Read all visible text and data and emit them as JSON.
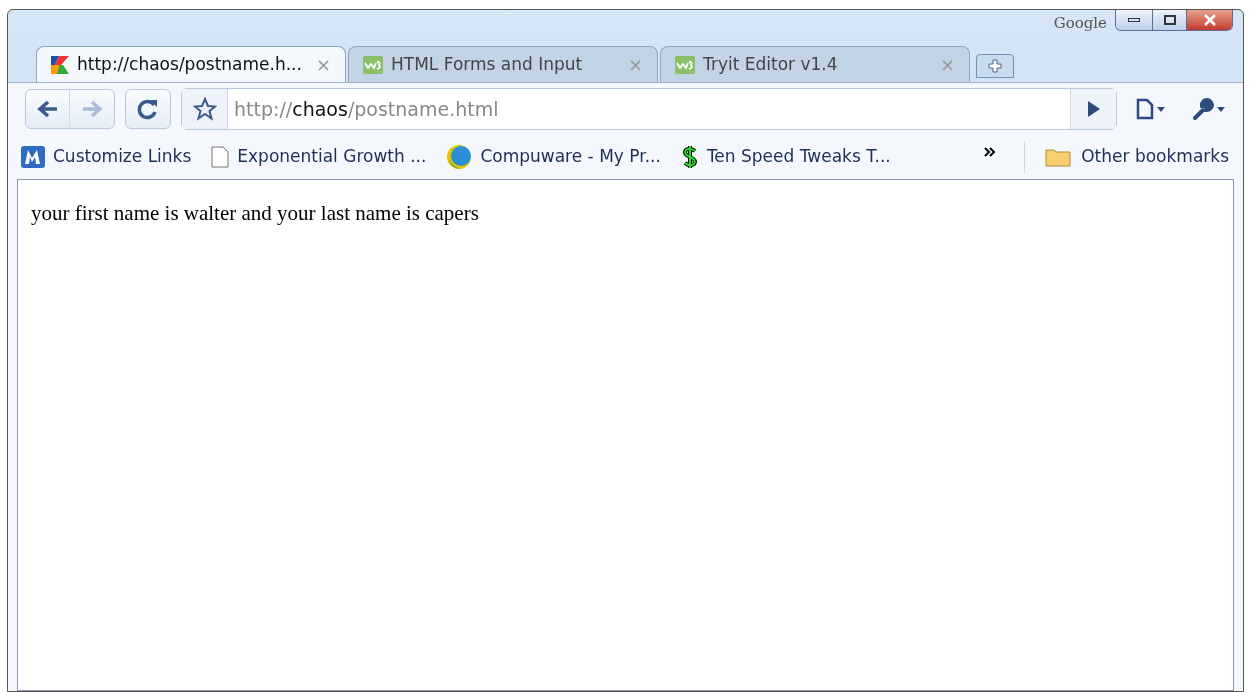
{
  "window": {
    "brand": "Google"
  },
  "tabs": [
    {
      "title": "http://chaos/postname.h...",
      "kind": "k",
      "selected": true,
      "close": "×"
    },
    {
      "title": "HTML Forms and Input",
      "kind": "w3",
      "selected": false,
      "close": "×"
    },
    {
      "title": "Tryit Editor v1.4",
      "kind": "w3",
      "selected": false,
      "close": "×"
    }
  ],
  "toolbar": {
    "forward_disabled": true,
    "url": {
      "scheme": "http://",
      "host": "chaos",
      "path": "/postname.html"
    }
  },
  "bookmarks": [
    {
      "label": "Customize Links",
      "kind": "m"
    },
    {
      "label": "Exponential Growth ...",
      "kind": "page"
    },
    {
      "label": "Compuware - My Pr...",
      "kind": "globe"
    },
    {
      "label": "Ten Speed Tweaks T...",
      "kind": "dollar"
    }
  ],
  "other_bookmarks": "Other bookmarks",
  "page_text": "your first name is walter and your last name is capers"
}
